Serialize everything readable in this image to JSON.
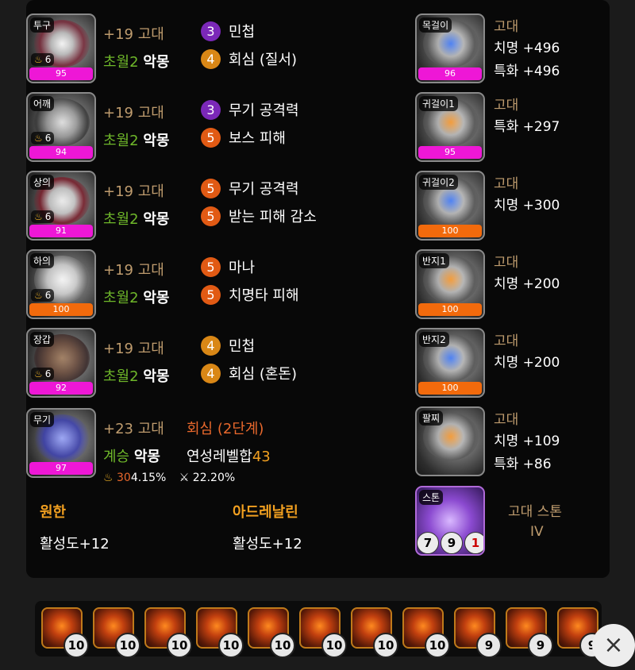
{
  "equipment": [
    {
      "slot": "투구",
      "tier": "6",
      "quality": "95",
      "qcolor": "pink",
      "refine": "+19",
      "grade": "고대",
      "tiername": "초월2",
      "setname": "악몽",
      "engrave1": {
        "lv": "3",
        "name": "민첩",
        "color": "purple"
      },
      "engrave2": {
        "lv": "4",
        "name": "회심 (질서)",
        "color": "orange"
      }
    },
    {
      "slot": "어깨",
      "tier": "6",
      "quality": "94",
      "qcolor": "pink",
      "refine": "+19",
      "grade": "고대",
      "tiername": "초월2",
      "setname": "악몽",
      "engrave1": {
        "lv": "3",
        "name": "무기 공격력",
        "color": "purple"
      },
      "engrave2": {
        "lv": "5",
        "name": "보스 피해",
        "color": "red"
      }
    },
    {
      "slot": "상의",
      "tier": "6",
      "quality": "91",
      "qcolor": "pink",
      "refine": "+19",
      "grade": "고대",
      "tiername": "초월2",
      "setname": "악몽",
      "engrave1": {
        "lv": "5",
        "name": "무기 공격력",
        "color": "red"
      },
      "engrave2": {
        "lv": "5",
        "name": "받는 피해 감소",
        "color": "red"
      }
    },
    {
      "slot": "하의",
      "tier": "6",
      "quality": "100",
      "qcolor": "orange",
      "refine": "+19",
      "grade": "고대",
      "tiername": "초월2",
      "setname": "악몽",
      "engrave1": {
        "lv": "5",
        "name": "마나",
        "color": "red"
      },
      "engrave2": {
        "lv": "5",
        "name": "치명타 피해",
        "color": "red"
      }
    },
    {
      "slot": "장갑",
      "tier": "6",
      "quality": "92",
      "qcolor": "pink",
      "refine": "+19",
      "grade": "고대",
      "tiername": "초월2",
      "setname": "악몽",
      "engrave1": {
        "lv": "4",
        "name": "민첩",
        "color": "orange"
      },
      "engrave2": {
        "lv": "4",
        "name": "회심 (혼돈)",
        "color": "orange"
      }
    }
  ],
  "weapon": {
    "slot": "무기",
    "quality": "97",
    "refine": "+23",
    "grade": "고대",
    "effect": "회심 (2단계)",
    "tiername": "계승",
    "setname": "악몽",
    "elixir": "연성레벨합",
    "elixir_value": "43",
    "flame_value": "30",
    "flame_pct": "4.15%",
    "sword_pct": "22.20%"
  },
  "elixir_left": {
    "title": "원한",
    "value": "활성도+12"
  },
  "elixir_right": {
    "title": "아드레날린",
    "value": "활성도+12"
  },
  "accessories": [
    {
      "slot": "목걸이",
      "quality": "96",
      "qcolor": "pink",
      "grade": "고대",
      "stats": [
        "치명 +496",
        "특화 +496"
      ]
    },
    {
      "slot": "귀걸이1",
      "quality": "95",
      "qcolor": "pink",
      "grade": "고대",
      "stats": [
        "특화 +297"
      ]
    },
    {
      "slot": "귀걸이2",
      "quality": "100",
      "qcolor": "orange",
      "grade": "고대",
      "stats": [
        "치명 +300"
      ]
    },
    {
      "slot": "반지1",
      "quality": "100",
      "qcolor": "orange",
      "grade": "고대",
      "stats": [
        "치명 +200"
      ]
    },
    {
      "slot": "반지2",
      "quality": "100",
      "qcolor": "orange",
      "grade": "고대",
      "stats": [
        "치명 +200"
      ]
    },
    {
      "slot": "팔찌",
      "grade": "고대",
      "stats": [
        "치명 +109",
        "특화 +86"
      ]
    }
  ],
  "stone": {
    "slot": "스톤",
    "name": "고대 스톤",
    "roman": "IV",
    "levels": [
      "7",
      "9",
      "1"
    ]
  },
  "gems": [
    "10",
    "10",
    "10",
    "10",
    "10",
    "10",
    "10",
    "10",
    "9",
    "9",
    "9"
  ],
  "close_icon": "×",
  "colors": {
    "pink": "#ee17d6",
    "orange": "#f26a0c",
    "purple": "#7b28b8",
    "engrave_orange": "#d98716",
    "engrave_red": "#e15a14",
    "grade": "#bf9c6e",
    "tier_green": "#6fb82a"
  }
}
